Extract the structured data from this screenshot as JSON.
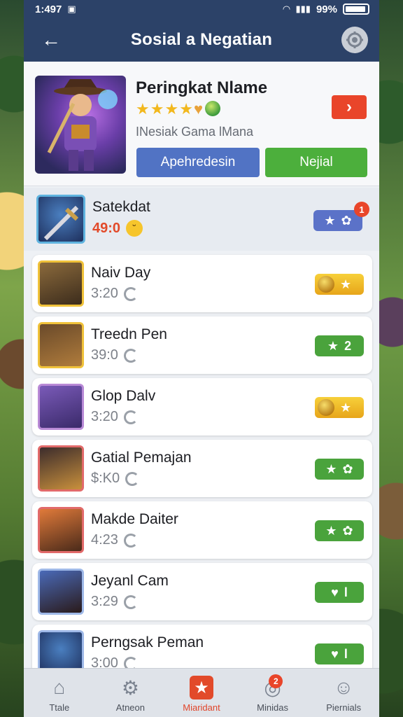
{
  "status_bar": {
    "time": "1:497",
    "battery": "99%"
  },
  "header": {
    "title": "Sosial a Negatian"
  },
  "profile": {
    "name": "Peringkat Nlame",
    "subtitle": "INesiak Gama lMana",
    "stars": [
      "★",
      "★",
      "★",
      "★"
    ],
    "primary_button": "Apehredesin",
    "secondary_button": "Nejial",
    "arrow": "›"
  },
  "list": [
    {
      "name": "Satekdat",
      "time": "49:0",
      "badge_type": "blue",
      "badge": "",
      "notification": "1",
      "accent": "#5fb3df"
    },
    {
      "name": "Naiv Day",
      "time": "3:20",
      "badge_type": "gold",
      "badge": "",
      "accent": "#f0c23a"
    },
    {
      "name": "Treedn Pen",
      "time": "39:0",
      "badge_type": "green",
      "badge": "2",
      "accent": "#f0c23a"
    },
    {
      "name": "Glop Dalv",
      "time": "3:20",
      "badge_type": "gold",
      "badge": "",
      "accent": "#f0c23a"
    },
    {
      "name": "Gatial Pemajan",
      "time": "$:K0",
      "badge_type": "green",
      "badge": "",
      "accent": "#e26a6a"
    },
    {
      "name": "Makde Daiter",
      "time": "4:23",
      "badge_type": "green",
      "badge": "",
      "accent": "#e26a6a"
    },
    {
      "name": "Jeyanl Cam",
      "time": "3:29",
      "badge_type": "green",
      "badge": "l",
      "accent": "#9fb9e8"
    },
    {
      "name": "Perngsak Peman",
      "time": "3:00",
      "badge_type": "green",
      "badge": "l",
      "accent": "#9fb9e8"
    }
  ],
  "nav": [
    {
      "label": "Ttale",
      "icon": "home-icon"
    },
    {
      "label": "Atneon",
      "icon": "gear-icon"
    },
    {
      "label": "Miaridant",
      "icon": "star-icon",
      "active": true
    },
    {
      "label": "Minidas",
      "icon": "chat-icon",
      "badge": "2"
    },
    {
      "label": "Piernials",
      "icon": "user-icon"
    }
  ],
  "colors": {
    "header": "#2c4268",
    "accent_red": "#e9452a",
    "green": "#4caf3c",
    "blue": "#5173c4"
  }
}
